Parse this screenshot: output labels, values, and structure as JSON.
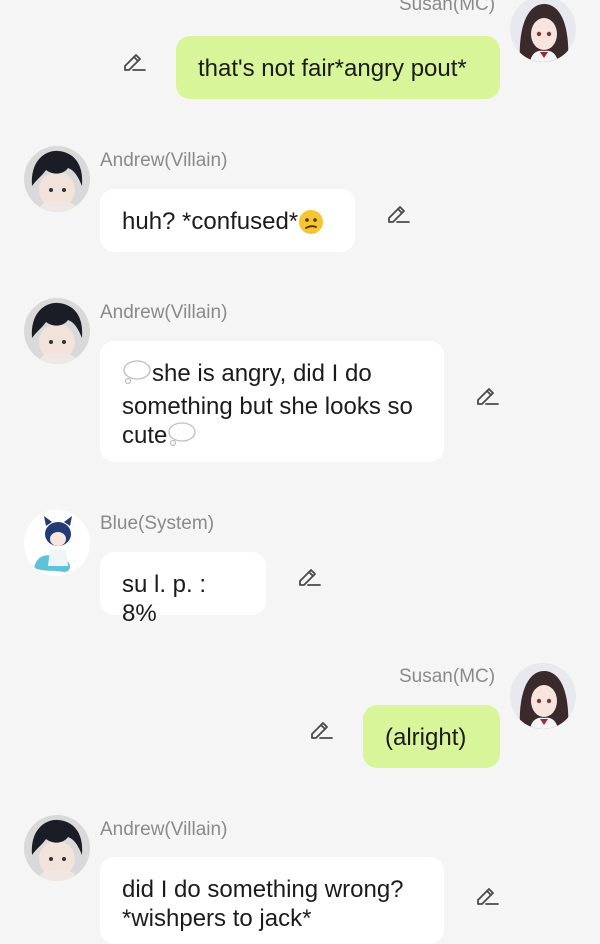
{
  "messages": [
    {
      "sender": "Susan(MC)",
      "text": "that's not fair*angry pout*",
      "side": "right"
    },
    {
      "sender": "Andrew(Villain)",
      "text_before": "huh? *confused*",
      "emoji": "confused-face",
      "side": "left"
    },
    {
      "sender": "Andrew(Villain)",
      "line1": "she is angry, did I do",
      "line2": "something but she looks so",
      "line3": "cute",
      "side": "left"
    },
    {
      "sender": "Blue(System)",
      "text": "su l. p. : 8%",
      "side": "left"
    },
    {
      "sender": "Susan(MC)",
      "text": "(alright)",
      "side": "right"
    },
    {
      "sender": "Andrew(Villain)",
      "line1": "did I do something wrong?",
      "line2": "*wishpers to jack*",
      "side": "left"
    }
  ],
  "colors": {
    "background": "#f5f5f5",
    "incoming_bubble": "#ffffff",
    "outgoing_bubble": "#d8f59a",
    "name_text": "#8a8a8a"
  },
  "icons": {
    "edit": "pencil-icon",
    "thought": "thought-bubble-icon",
    "emoji": "confused-face-icon"
  }
}
